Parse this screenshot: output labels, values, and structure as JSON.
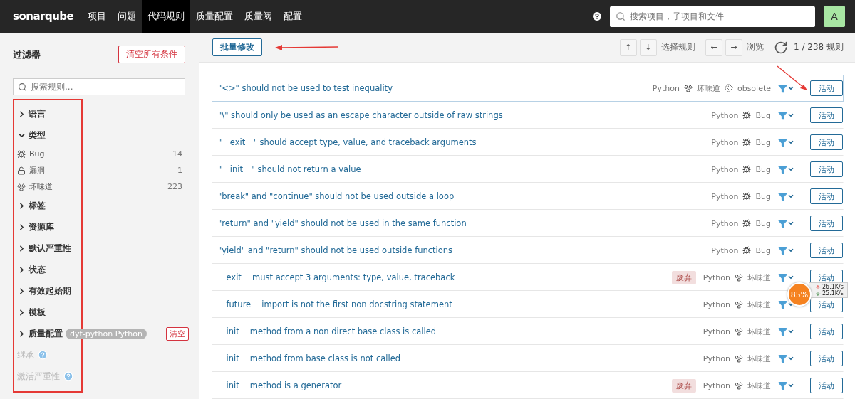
{
  "navbar": {
    "logo": "sonarqube",
    "items": [
      {
        "label": "项目",
        "selected": false
      },
      {
        "label": "问题",
        "selected": false
      },
      {
        "label": "代码规则",
        "selected": true
      },
      {
        "label": "质量配置",
        "selected": false
      },
      {
        "label": "质量阈",
        "selected": false
      },
      {
        "label": "配置",
        "selected": false
      }
    ],
    "search": {
      "placeholder": "搜索项目，子项目和文件"
    },
    "avatar": "A"
  },
  "sidebar": {
    "title": "过滤器",
    "clear_all": "清空所有条件",
    "search": {
      "placeholder": "搜索规则..."
    },
    "facets": [
      {
        "kind": "facet",
        "label": "语言",
        "expanded": false
      },
      {
        "kind": "facet",
        "label": "类型",
        "expanded": true,
        "items": [
          {
            "kind": "bug",
            "label": "Bug",
            "count": "14"
          },
          {
            "kind": "vulnerability",
            "label": "漏洞",
            "count": "1"
          },
          {
            "kind": "smell",
            "label": "坏味道",
            "count": "223"
          }
        ]
      },
      {
        "kind": "facet",
        "label": "标签",
        "expanded": false
      },
      {
        "kind": "facet",
        "label": "资源库",
        "expanded": false
      },
      {
        "kind": "facet",
        "label": "默认严重性",
        "expanded": false
      },
      {
        "kind": "facet",
        "label": "状态",
        "expanded": false
      },
      {
        "kind": "facet",
        "label": "有效起始期",
        "expanded": false
      },
      {
        "kind": "facet",
        "label": "模板",
        "expanded": false
      },
      {
        "kind": "profile",
        "label": "质量配置",
        "expanded": false,
        "value": "dyt-python Python",
        "clear": "清空"
      },
      {
        "kind": "disabled",
        "label": "继承"
      },
      {
        "kind": "disabled",
        "label": "激活严重性"
      }
    ]
  },
  "toolbar": {
    "bulk_change": "批量修改",
    "up": "↑",
    "down": "↓",
    "select_label": "选择规则",
    "prev": "←",
    "next": "→",
    "browse_label": "浏览",
    "count": "1 / 238 规则"
  },
  "rules": [
    {
      "title": "\"<>\" should not be used to test inequality",
      "language": "Python",
      "kind": "smell",
      "type_label": "坏味道",
      "tag": "obsolete",
      "selected": true,
      "action": "活动"
    },
    {
      "title": "\"\\\" should only be used as an escape character outside of raw strings",
      "language": "Python",
      "kind": "bug",
      "type_label": "Bug",
      "selected": false,
      "action": "活动"
    },
    {
      "title": "\"__exit__\" should accept type, value, and traceback arguments",
      "language": "Python",
      "kind": "bug",
      "type_label": "Bug",
      "selected": false,
      "action": "活动"
    },
    {
      "title": "\"__init__\" should not return a value",
      "language": "Python",
      "kind": "bug",
      "type_label": "Bug",
      "selected": false,
      "action": "活动"
    },
    {
      "title": "\"break\" and \"continue\" should not be used outside a loop",
      "language": "Python",
      "kind": "bug",
      "type_label": "Bug",
      "selected": false,
      "action": "活动"
    },
    {
      "title": "\"return\" and \"yield\" should not be used in the same function",
      "language": "Python",
      "kind": "bug",
      "type_label": "Bug",
      "selected": false,
      "action": "活动"
    },
    {
      "title": "\"yield\" and \"return\" should not be used outside functions",
      "language": "Python",
      "kind": "bug",
      "type_label": "Bug",
      "selected": false,
      "action": "活动"
    },
    {
      "title": "__exit__ must accept 3 arguments: type, value, traceback",
      "language": "Python",
      "kind": "smell",
      "type_label": "坏味道",
      "deprecated": "废弃",
      "selected": false,
      "action": "活动"
    },
    {
      "title": "__future__ import is not the first non docstring statement",
      "language": "Python",
      "kind": "smell",
      "type_label": "坏味道",
      "selected": false,
      "action": "活动"
    },
    {
      "title": "__init__ method from a non direct base class is called",
      "language": "Python",
      "kind": "smell",
      "type_label": "坏味道",
      "selected": false,
      "action": "活动"
    },
    {
      "title": "__init__ method from base class is not called",
      "language": "Python",
      "kind": "smell",
      "type_label": "坏味道",
      "selected": false,
      "action": "活动"
    },
    {
      "title": "__init__ method is a generator",
      "language": "Python",
      "kind": "smell",
      "type_label": "坏味道",
      "deprecated": "废弃",
      "selected": false,
      "action": "活动"
    }
  ],
  "net_meter": {
    "percent": "85%",
    "up": "26.1K/s",
    "down": "25.1K/s"
  }
}
